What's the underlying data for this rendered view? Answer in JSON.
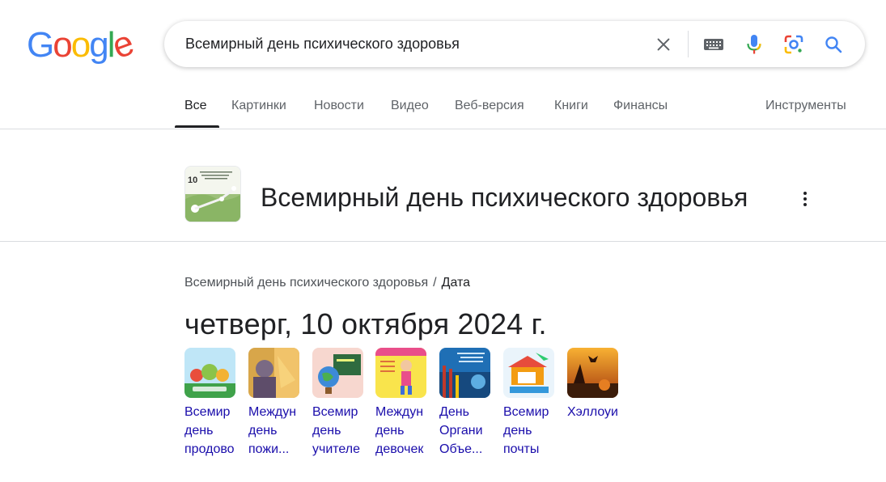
{
  "logo": {
    "letters": [
      "G",
      "o",
      "o",
      "g",
      "l",
      "e"
    ],
    "colors": [
      "#4285F4",
      "#EA4335",
      "#FBBC05",
      "#4285F4",
      "#34A853",
      "#EA4335"
    ]
  },
  "search": {
    "query": "Всемирный день психического здоровья",
    "icons": [
      "clear-icon",
      "keyboard-icon",
      "mic-icon",
      "lens-icon",
      "search-icon"
    ]
  },
  "tabs": [
    {
      "label": "Все",
      "active": true
    },
    {
      "label": "Картинки"
    },
    {
      "label": "Новости"
    },
    {
      "label": "Видео"
    },
    {
      "label": "Веб-версия"
    },
    {
      "label": "Книги"
    },
    {
      "label": "Финансы"
    }
  ],
  "tools_label": "Инструменты",
  "knowledge_panel": {
    "title": "Всемирный день психического здоровья",
    "thumb_text": "10"
  },
  "breadcrumb": {
    "parent": "Всемирный день психического здоровья",
    "separator": "/",
    "current": "Дата"
  },
  "answer": "четверг, 10 октября 2024 г.",
  "related": [
    {
      "lines": [
        "Всемир",
        "день",
        "продово"
      ]
    },
    {
      "lines": [
        "Междун",
        "день",
        "пожи..."
      ]
    },
    {
      "lines": [
        "Всемир",
        "день",
        "учителе"
      ]
    },
    {
      "lines": [
        "Междун",
        "день",
        "девочек"
      ]
    },
    {
      "lines": [
        "День",
        "Органи",
        "Объе..."
      ]
    },
    {
      "lines": [
        "Всемир",
        "день",
        "почты"
      ]
    },
    {
      "lines": [
        "Хэллоуи"
      ]
    }
  ],
  "colors": {
    "link": "#1a0dab",
    "text": "#202124",
    "muted": "#5f6368",
    "divider": "#dadce0"
  }
}
